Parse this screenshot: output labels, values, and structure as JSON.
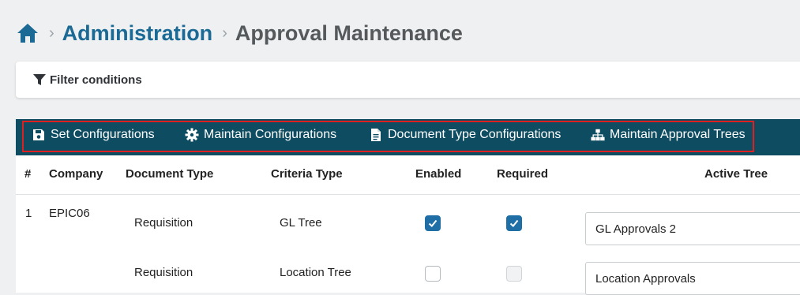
{
  "breadcrumb": {
    "home_icon": "home-icon",
    "parent": "Administration",
    "current": "Approval Maintenance"
  },
  "filter": {
    "icon": "filter-icon",
    "label": "Filter conditions"
  },
  "toolbar": {
    "buttons": [
      {
        "label": "Set Configurations",
        "icon": "save-icon"
      },
      {
        "label": "Maintain Configurations",
        "icon": "gear-icon"
      },
      {
        "label": "Document Type Configurations",
        "icon": "document-icon"
      },
      {
        "label": "Maintain Approval Trees",
        "icon": "hierarchy-icon"
      }
    ],
    "highlight_color": "#e02020",
    "background": "#0e4c61"
  },
  "table": {
    "columns": [
      "#",
      "Company",
      "Document Type",
      "Criteria Type",
      "Enabled",
      "Required",
      "Active Tree"
    ],
    "rows": [
      {
        "index": "1",
        "company": "EPIC06",
        "document_type": "Requisition",
        "criteria_type": "GL Tree",
        "enabled": true,
        "required": true,
        "required_disabled": false,
        "active_tree": "GL Approvals 2"
      },
      {
        "index": "",
        "company": "",
        "document_type": "Requisition",
        "criteria_type": "Location Tree",
        "enabled": false,
        "required": false,
        "required_disabled": true,
        "active_tree": "Location Approvals"
      }
    ]
  }
}
